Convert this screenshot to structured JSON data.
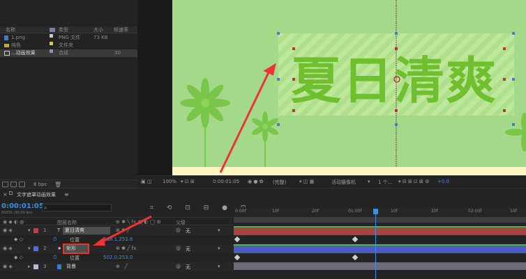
{
  "project": {
    "columns": [
      "名称",
      "类型",
      "大小",
      "帧速率"
    ],
    "items": [
      {
        "name": "1.png",
        "type": "PNG 文件",
        "size": "73 KB",
        "fps": "",
        "color": "#c9c9c9"
      },
      {
        "name": "纯色",
        "type": "文件夹",
        "size": "",
        "fps": "",
        "color": "#d6c84a"
      },
      {
        "name": "...动画效果",
        "type": "合成",
        "size": "",
        "fps": "30",
        "color": "#8f8fb0"
      }
    ],
    "footer_bpc": "8 bpc"
  },
  "viewer": {
    "headline": "夏日清爽",
    "zoom": "100%",
    "timecode": "0:00:01:05",
    "resolution": "(完整)",
    "camera": "活动摄像机",
    "views": "1 个...",
    "exposure": "+0.0"
  },
  "timeline": {
    "tab_title": "文字遮罩动画效果",
    "timecode": "0:00:01:05",
    "timecode_sub": "00035 (30.00 fps)",
    "search_placeholder": "",
    "header_layer_name": "图层名称",
    "header_mode": "父级",
    "parent_none": "无",
    "ruler_labels": [
      "0:00f",
      "10f",
      "20f",
      "01:00f",
      "10f",
      "20f",
      "02:00f",
      "10f"
    ],
    "layers": [
      {
        "index": "1",
        "type": "T",
        "name": "夏日清爽",
        "color": "#b44545",
        "prop": "位置",
        "prop_value": "568.1,253.6"
      },
      {
        "index": "2",
        "type": "★",
        "name": "矩形",
        "color": "#5a6ac7",
        "prop": "位置",
        "prop_value": "502.0,253.0"
      },
      {
        "index": "3",
        "type": "",
        "name": "背景",
        "color": "#b8b8d0",
        "prop": "",
        "prop_value": ""
      }
    ],
    "colors": {
      "accent": "#3b8ee6",
      "red_track": "#a94444",
      "blue_track": "#4a5cc0"
    }
  },
  "annotation": {
    "color": "#ee3333"
  }
}
